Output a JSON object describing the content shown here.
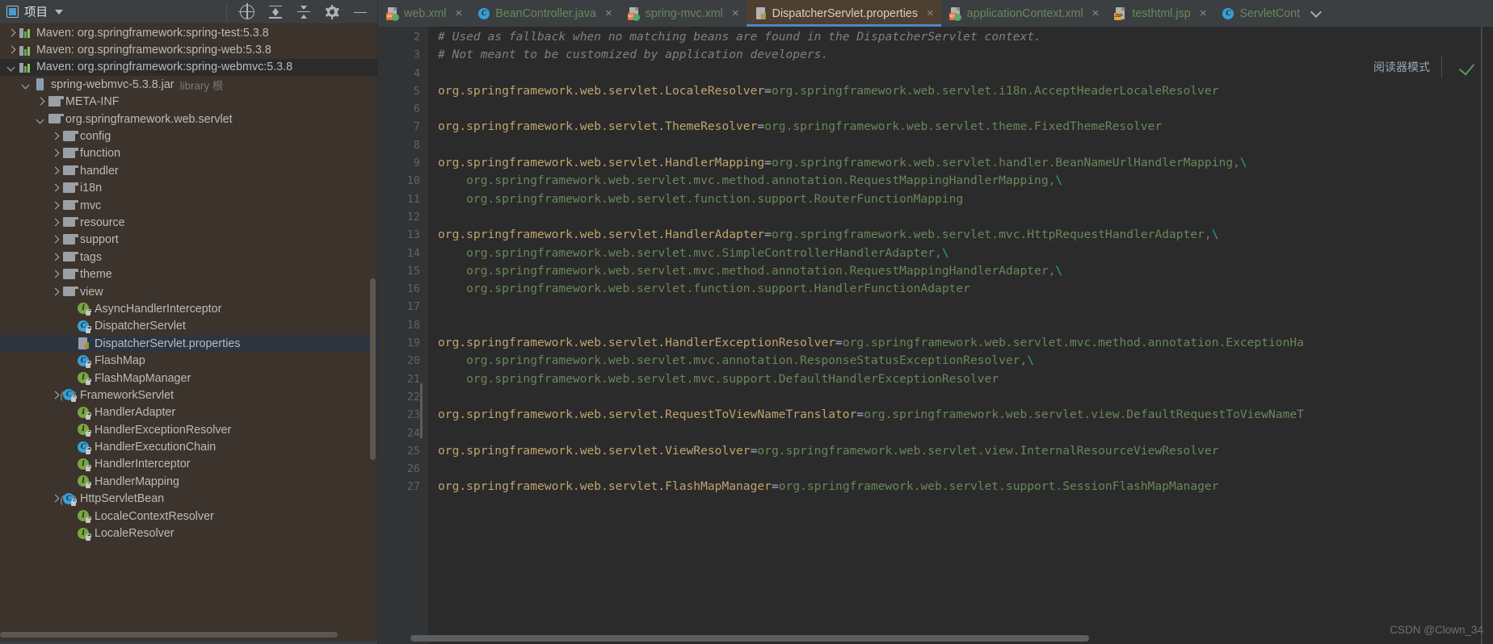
{
  "project_panel": {
    "title": "项目",
    "icons": [
      "project-icon",
      "chevron-down-icon"
    ],
    "tools": [
      "locate-target-icon",
      "collapse-all-icon",
      "expand-all-icon",
      "gear-icon",
      "minimize-icon"
    ],
    "tree": [
      {
        "indent": 1,
        "chevron": "right",
        "icon": "maven-module-icon",
        "label": "Maven: org.springframework:spring-test:5.3.8"
      },
      {
        "indent": 1,
        "chevron": "right",
        "icon": "maven-module-icon",
        "label": "Maven: org.springframework:spring-web:5.3.8"
      },
      {
        "indent": 1,
        "chevron": "down",
        "icon": "maven-module-icon",
        "label": "Maven: org.springframework:spring-webmvc:5.3.8",
        "header": true
      },
      {
        "indent": 2,
        "chevron": "down",
        "icon": "jar-icon",
        "label": "spring-webmvc-5.3.8.jar",
        "sublabel": "library 根"
      },
      {
        "indent": 3,
        "chevron": "right",
        "icon": "folder-icon",
        "label": "META-INF"
      },
      {
        "indent": 3,
        "chevron": "down",
        "icon": "folder-icon",
        "label": "org.springframework.web.servlet"
      },
      {
        "indent": 4,
        "chevron": "right",
        "icon": "folder-icon",
        "label": "config"
      },
      {
        "indent": 4,
        "chevron": "right",
        "icon": "folder-icon",
        "label": "function"
      },
      {
        "indent": 4,
        "chevron": "right",
        "icon": "folder-icon",
        "label": "handler"
      },
      {
        "indent": 4,
        "chevron": "right",
        "icon": "folder-icon",
        "label": "i18n"
      },
      {
        "indent": 4,
        "chevron": "right",
        "icon": "folder-icon",
        "label": "mvc"
      },
      {
        "indent": 4,
        "chevron": "right",
        "icon": "folder-icon",
        "label": "resource"
      },
      {
        "indent": 4,
        "chevron": "right",
        "icon": "folder-icon",
        "label": "support"
      },
      {
        "indent": 4,
        "chevron": "right",
        "icon": "folder-icon",
        "label": "tags"
      },
      {
        "indent": 4,
        "chevron": "right",
        "icon": "folder-icon",
        "label": "theme"
      },
      {
        "indent": 4,
        "chevron": "right",
        "icon": "folder-icon",
        "label": "view"
      },
      {
        "indent": 5,
        "chevron": "none",
        "icon": "interface-icon",
        "label": "AsyncHandlerInterceptor"
      },
      {
        "indent": 5,
        "chevron": "none",
        "icon": "class-icon",
        "label": "DispatcherServlet"
      },
      {
        "indent": 5,
        "chevron": "none",
        "icon": "properties-file-icon",
        "label": "DispatcherServlet.properties",
        "selected": true
      },
      {
        "indent": 5,
        "chevron": "none",
        "icon": "class-icon",
        "label": "FlashMap"
      },
      {
        "indent": 5,
        "chevron": "none",
        "icon": "interface-icon",
        "label": "FlashMapManager"
      },
      {
        "indent": 4,
        "chevron": "right",
        "icon": "abstract-class-icon",
        "label": "FrameworkServlet"
      },
      {
        "indent": 5,
        "chevron": "none",
        "icon": "interface-icon",
        "label": "HandlerAdapter"
      },
      {
        "indent": 5,
        "chevron": "none",
        "icon": "interface-icon",
        "label": "HandlerExceptionResolver"
      },
      {
        "indent": 5,
        "chevron": "none",
        "icon": "class-icon",
        "label": "HandlerExecutionChain"
      },
      {
        "indent": 5,
        "chevron": "none",
        "icon": "interface-icon",
        "label": "HandlerInterceptor"
      },
      {
        "indent": 5,
        "chevron": "none",
        "icon": "interface-icon",
        "label": "HandlerMapping"
      },
      {
        "indent": 4,
        "chevron": "right",
        "icon": "abstract-class-icon",
        "label": "HttpServletBean"
      },
      {
        "indent": 5,
        "chevron": "none",
        "icon": "interface-icon",
        "label": "LocaleContextResolver"
      },
      {
        "indent": 5,
        "chevron": "none",
        "icon": "interface-icon",
        "label": "LocaleResolver"
      }
    ]
  },
  "editor": {
    "tabs": [
      {
        "label": "web.xml",
        "icon": "xml-file-icon",
        "active": false,
        "close": "×"
      },
      {
        "label": "BeanController.java",
        "icon": "java-class-icon",
        "active": false,
        "close": "×"
      },
      {
        "label": "spring-mvc.xml",
        "icon": "xml-file-icon",
        "active": false,
        "close": "×"
      },
      {
        "label": "DispatcherServlet.properties",
        "icon": "properties-file-icon",
        "active": true,
        "close": "×"
      },
      {
        "label": "applicationContext.xml",
        "icon": "xml-file-icon",
        "active": false,
        "close": "×"
      },
      {
        "label": "testhtml.jsp",
        "icon": "jsp-file-icon",
        "active": false,
        "close": "×"
      },
      {
        "label": "ServletCont",
        "icon": "java-class-icon",
        "active": false,
        "close": ""
      }
    ],
    "reader_mode_label": "阅读器模式",
    "inspection_icon": "green-check-icon",
    "line_numbers": [
      "2",
      "3",
      "4",
      "5",
      "6",
      "7",
      "8",
      "9",
      "10",
      "11",
      "12",
      "13",
      "14",
      "15",
      "16",
      "17",
      "18",
      "19",
      "20",
      "21",
      "22",
      "23",
      "24",
      "25",
      "26",
      "27"
    ],
    "lines": [
      {
        "n": "2",
        "type": "comment",
        "text": "# Used as fallback when no matching beans are found in the DispatcherServlet context."
      },
      {
        "n": "3",
        "type": "comment",
        "text": "# Not meant to be customized by application developers."
      },
      {
        "n": "4",
        "type": "blank",
        "text": ""
      },
      {
        "n": "5",
        "type": "prop",
        "key": "org.springframework.web.servlet.LocaleResolver",
        "value": "org.springframework.web.servlet.i18n.AcceptHeaderLocaleResolver"
      },
      {
        "n": "6",
        "type": "blank",
        "text": ""
      },
      {
        "n": "7",
        "type": "prop",
        "key": "org.springframework.web.servlet.ThemeResolver",
        "value": "org.springframework.web.servlet.theme.FixedThemeResolver"
      },
      {
        "n": "8",
        "type": "blank",
        "text": ""
      },
      {
        "n": "9",
        "type": "prop",
        "key": "org.springframework.web.servlet.HandlerMapping",
        "value": "org.springframework.web.servlet.handler.BeanNameUrlHandlerMapping,\\"
      },
      {
        "n": "10",
        "type": "cont",
        "text": "org.springframework.web.servlet.mvc.method.annotation.RequestMappingHandlerMapping,\\"
      },
      {
        "n": "11",
        "type": "cont",
        "text": "org.springframework.web.servlet.function.support.RouterFunctionMapping"
      },
      {
        "n": "12",
        "type": "blank",
        "text": ""
      },
      {
        "n": "13",
        "type": "prop",
        "key": "org.springframework.web.servlet.HandlerAdapter",
        "value": "org.springframework.web.servlet.mvc.HttpRequestHandlerAdapter,\\"
      },
      {
        "n": "14",
        "type": "cont",
        "text": "org.springframework.web.servlet.mvc.SimpleControllerHandlerAdapter,\\"
      },
      {
        "n": "15",
        "type": "cont",
        "text": "org.springframework.web.servlet.mvc.method.annotation.RequestMappingHandlerAdapter,\\"
      },
      {
        "n": "16",
        "type": "cont",
        "text": "org.springframework.web.servlet.function.support.HandlerFunctionAdapter"
      },
      {
        "n": "17",
        "type": "blank",
        "text": ""
      },
      {
        "n": "18",
        "type": "blank",
        "text": ""
      },
      {
        "n": "19",
        "type": "prop",
        "key": "org.springframework.web.servlet.HandlerExceptionResolver",
        "value": "org.springframework.web.servlet.mvc.method.annotation.ExceptionHa"
      },
      {
        "n": "20",
        "type": "cont",
        "text": "org.springframework.web.servlet.mvc.annotation.ResponseStatusExceptionResolver,\\"
      },
      {
        "n": "21",
        "type": "cont",
        "text": "org.springframework.web.servlet.mvc.support.DefaultHandlerExceptionResolver"
      },
      {
        "n": "22",
        "type": "blank",
        "text": ""
      },
      {
        "n": "23",
        "type": "prop",
        "key": "org.springframework.web.servlet.RequestToViewNameTranslator",
        "value": "org.springframework.web.servlet.view.DefaultRequestToViewNameT"
      },
      {
        "n": "24",
        "type": "blank",
        "text": ""
      },
      {
        "n": "25",
        "type": "prop",
        "key": "org.springframework.web.servlet.ViewResolver",
        "value": "org.springframework.web.servlet.view.InternalResourceViewResolver"
      },
      {
        "n": "26",
        "type": "blank",
        "text": ""
      },
      {
        "n": "27",
        "type": "prop",
        "key": "org.springframework.web.servlet.FlashMapManager",
        "value": "org.springframework.web.servlet.support.SessionFlashMapManager"
      }
    ]
  },
  "watermark": "CSDN @Clown_34",
  "colors": {
    "editor_bg": "#2b2b2b",
    "panel_bg": "#3b332c",
    "toolbar_bg": "#3c3f41",
    "selection": "#2f3441",
    "active_tab": "#4e3f30",
    "active_tab_underline": "#4a88c7",
    "key_color": "#bfa46f",
    "value_color": "#6a8759",
    "comment_color": "#808080",
    "line_number_color": "#606366"
  }
}
